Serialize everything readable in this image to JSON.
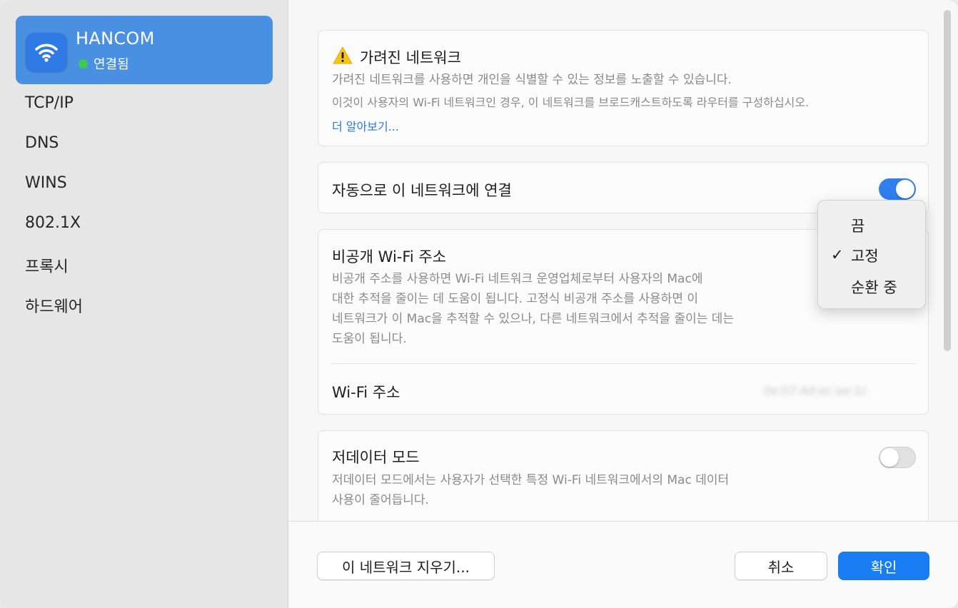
{
  "sidebar": {
    "network": {
      "name": "HANCOM",
      "status": "연결됨",
      "status_color": "#3ccb4a",
      "icon": "wifi-icon"
    },
    "items": [
      {
        "label": "TCP/IP"
      },
      {
        "label": "DNS"
      },
      {
        "label": "WINS"
      },
      {
        "label": "802.1X"
      },
      {
        "label": "프록시"
      },
      {
        "label": "하드웨어"
      }
    ]
  },
  "hidden_network": {
    "title": "가려진 네트워크",
    "icon": "warning-icon",
    "desc1": "가려진 네트워크를 사용하면 개인을 식별할 수 있는 정보를 노출할 수 있습니다.",
    "desc2": "이것이 사용자의 Wi-Fi 네트워크인 경우, 이 네트워크를 브로드캐스트하도록 라우터를 구성하십시오.",
    "link": "더 알아보기..."
  },
  "auto_connect": {
    "label": "자동으로 이 네트워크에 연결",
    "enabled": true
  },
  "private_address": {
    "title": "비공개 Wi-Fi 주소",
    "desc": [
      "비공개 주소를 사용하면 Wi-Fi 네트워크 운영업체로부터 사용자의 Mac에",
      "대한 추적을 줄이는 데 도움이 됩니다. 고정식 비공개 주소를 사용하면 이",
      "네트워크가 이 Mac을 추적할 수 있으나, 다른 네트워크에서 추적을 줄이는 데는",
      "도움이 됩니다."
    ],
    "wifi_address_label": "Wi-Fi 주소",
    "wifi_address_value": "0e:07:4d:ec:ae:1c"
  },
  "low_data": {
    "title": "저데이터 모드",
    "desc": [
      "저데이터 모드에서는 사용자가 선택한 특정 Wi-Fi 네트워크에서의 Mac 데이터",
      "사용이 줄어듭니다."
    ],
    "enabled": false
  },
  "popup_menu": {
    "options": [
      "끔",
      "고정",
      "순환 중"
    ],
    "selected": "고정",
    "check": "✓"
  },
  "footer": {
    "forget_label": "이 네트워크 지우기...",
    "cancel_label": "취소",
    "ok_label": "확인"
  },
  "colors": {
    "accent": "#1a7cf3",
    "selection": "#4a90e2",
    "warning": "#f5c518"
  }
}
